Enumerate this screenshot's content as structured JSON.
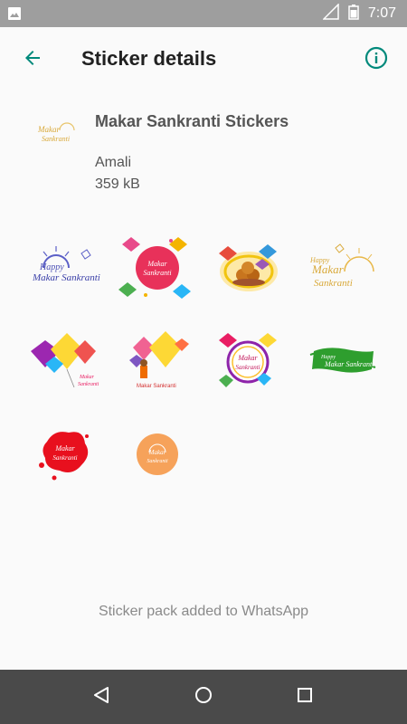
{
  "status_bar": {
    "time": "7:07",
    "icons": [
      "image-icon",
      "signal-icon",
      "battery-icon"
    ]
  },
  "app_bar": {
    "title": "Sticker details",
    "back_icon": "arrow-back-icon",
    "info_icon": "info-icon",
    "accent_color": "#00897b"
  },
  "pack": {
    "name": "Makar Sankranti Stickers",
    "publisher": "Amali",
    "size": "359 kB"
  },
  "stickers": [
    {
      "name": "sticker-happy-makar-sankranti-blue",
      "text": "Happy Makar Sankranti"
    },
    {
      "name": "sticker-makar-sankranti-red-circle",
      "text": "Makar Sankranti"
    },
    {
      "name": "sticker-laddoo-kites",
      "text": ""
    },
    {
      "name": "sticker-makar-sankranti-gold",
      "text": "Makar Sankranti"
    },
    {
      "name": "sticker-kites-colorful",
      "text": "Makar Sankranti"
    },
    {
      "name": "sticker-kites-boy",
      "text": "Makar Sankranti"
    },
    {
      "name": "sticker-makar-sankranti-frame",
      "text": "Makar Sankranti"
    },
    {
      "name": "sticker-green-brush",
      "text": "Happy Makar Sankranti"
    },
    {
      "name": "sticker-red-splash",
      "text": "Makar Sankranti"
    },
    {
      "name": "sticker-orange-circle",
      "text": "Makar Sankranti"
    }
  ],
  "footer": {
    "message": "Sticker pack added to WhatsApp"
  },
  "nav_bar": {
    "icons": [
      "back-triangle-icon",
      "home-circle-icon",
      "recents-square-icon"
    ]
  }
}
